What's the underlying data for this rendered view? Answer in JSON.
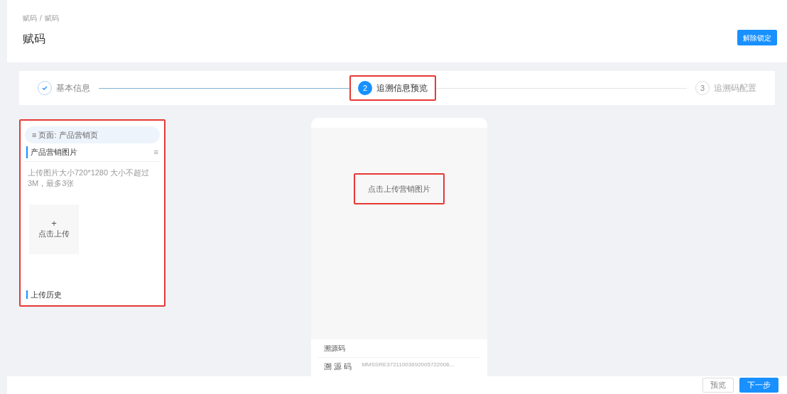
{
  "breadcrumb": [
    "赋码",
    "赋码"
  ],
  "breadcrumb_separator": "/",
  "title": "赋码",
  "header_button": "解除锁定",
  "steps": [
    {
      "label": "基本信息",
      "completed": true,
      "selected": false,
      "highlighted": false
    },
    {
      "number": "2",
      "label": "追溯信息预览",
      "completed": false,
      "selected": true,
      "highlighted": true
    },
    {
      "number": "3",
      "label": "追溯码配置",
      "completed": false,
      "selected": false,
      "highlighted": false
    }
  ],
  "left_panel": {
    "highlighted": true,
    "page_tab": "≡ 页面: 产品营销页",
    "section_title": "产品营销图片",
    "section_toggle": "≡",
    "hint": "上传图片大小720*1280 大小不超过3M，最多3张",
    "upload_plus": "+",
    "upload_label": "点击上传",
    "history_title": "上传历史"
  },
  "preview": {
    "upload_prompt": "点击上传营销图片",
    "upload_prompt_highlighted": true,
    "info_title": "溯源码",
    "info_rows": [
      {
        "label": "溯 源 码",
        "value": "MMSSRE37211003692005722006..."
      }
    ]
  },
  "footer_buttons": [
    {
      "label": "预览",
      "kind": "secondary"
    },
    {
      "label": "下一步",
      "kind": "primary"
    }
  ]
}
